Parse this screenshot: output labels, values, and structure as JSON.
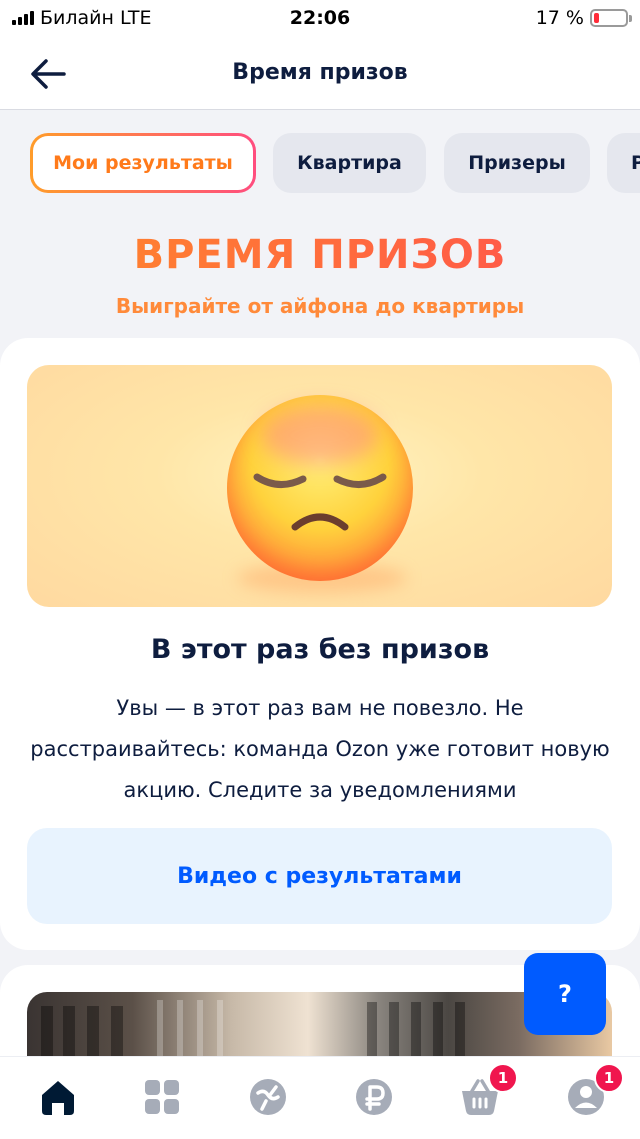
{
  "status_bar": {
    "carrier": "Билайн",
    "network": "LTE",
    "time": "22:06",
    "battery_percent": "17 %",
    "battery_level": 0.17
  },
  "header": {
    "title": "Время призов",
    "back_icon": "arrow-left-icon"
  },
  "tabs": [
    {
      "label": "Мои результаты",
      "active": true
    },
    {
      "label": "Квартира",
      "active": false
    },
    {
      "label": "Призеры",
      "active": false
    },
    {
      "label": "Р",
      "active": false
    }
  ],
  "hero": {
    "title": "ВРЕМЯ ПРИЗОВ",
    "subtitle": "Выиграйте от айфона до квартиры"
  },
  "result_card": {
    "image_icon": "pensive-face-emoji",
    "title": "В этот раз без призов",
    "text": "Увы — в этот раз вам не повезло. Не расстраивайтесь: команда Ozon уже готовит новую акцию. Следите за уведомлениями",
    "button_label": "Видео с результатами"
  },
  "help_button": {
    "label": "?"
  },
  "bottom_nav": {
    "items": [
      {
        "icon": "home-icon"
      },
      {
        "icon": "catalog-icon"
      },
      {
        "icon": "fresh-icon"
      },
      {
        "icon": "ruble-icon"
      },
      {
        "icon": "cart-icon",
        "badge": "1"
      },
      {
        "icon": "profile-icon",
        "badge": "1"
      }
    ]
  },
  "colors": {
    "accent": "#005bff",
    "hero_gradient_start": "#ff8a2a",
    "hero_gradient_end": "#ff4f4f",
    "badge": "#f0164e"
  }
}
